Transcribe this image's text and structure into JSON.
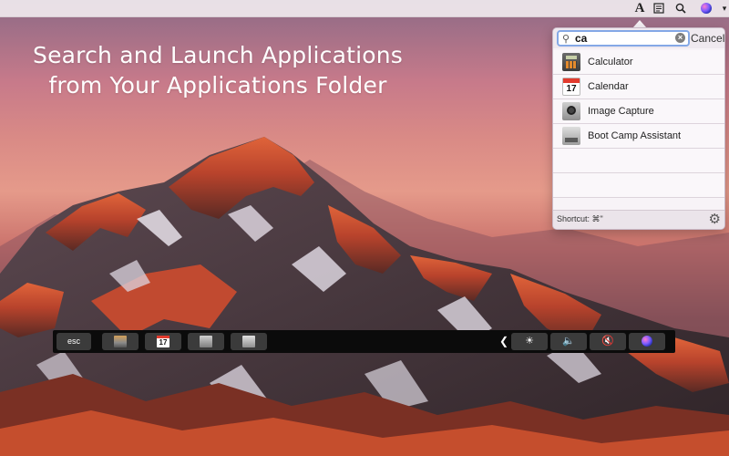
{
  "headline": {
    "line1": "Search and Launch Applications",
    "line2": "from Your Applications Folder"
  },
  "menubar": {
    "icons": [
      "app-launcher-icon",
      "notes-icon",
      "search-icon",
      "siri-icon",
      "chevron-down-icon"
    ],
    "app_glyph": "A"
  },
  "popup": {
    "search": {
      "value": "ca",
      "cancel_label": "Cancel"
    },
    "results": [
      {
        "label": "Calculator",
        "icon": "calculator-icon"
      },
      {
        "label": "Calendar",
        "icon": "calendar-icon",
        "day": "17"
      },
      {
        "label": "Image Capture",
        "icon": "image-capture-icon"
      },
      {
        "label": "Boot Camp Assistant",
        "icon": "boot-camp-icon"
      }
    ],
    "footer": {
      "shortcut": "Shortcut: ⌘\""
    }
  },
  "touchbar": {
    "esc_label": "esc",
    "calendar_day": "17",
    "control_strip": {
      "collapse": "❮",
      "brightness": "☀",
      "volume": "🔈",
      "mute": "🔇"
    }
  },
  "colors": {
    "accent_focus": "#84a8e6",
    "touchbar_bg": "#0b0b0b",
    "panel_bg": "#f7f3f7"
  }
}
